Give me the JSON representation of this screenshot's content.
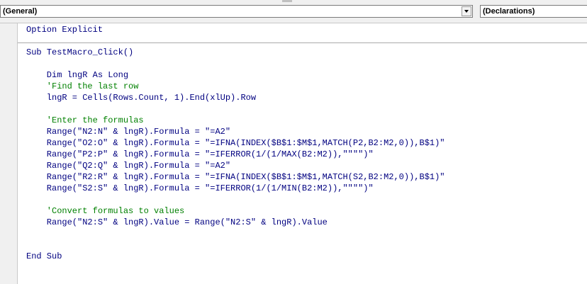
{
  "toolbar": {
    "object_combo": "(General)",
    "procedure_combo": "(Declarations)"
  },
  "code": {
    "option_explicit": "Option Explicit",
    "sub_decl": "Sub TestMacro_Click()",
    "dim_line": "    Dim lngR As Long",
    "comment_last_row": "    'Find the last row",
    "lngR_assign": "    lngR = Cells(Rows.Count, 1).End(xlUp).Row",
    "comment_formulas": "    'Enter the formulas",
    "range_n": "    Range(\"N2:N\" & lngR).Formula = \"=A2\"",
    "range_o": "    Range(\"O2:O\" & lngR).Formula = \"=IFNA(INDEX($B$1:$M$1,MATCH(P2,B2:M2,0)),B$1)\"",
    "range_p": "    Range(\"P2:P\" & lngR).Formula = \"=IFERROR(1/(1/MAX(B2:M2)),\"\"\"\")\"",
    "range_q": "    Range(\"Q2:Q\" & lngR).Formula = \"=A2\"",
    "range_r": "    Range(\"R2:R\" & lngR).Formula = \"=IFNA(INDEX($B$1:$M$1,MATCH(S2,B2:M2,0)),B$1)\"",
    "range_s": "    Range(\"S2:S\" & lngR).Formula = \"=IFERROR(1/(1/MIN(B2:M2)),\"\"\"\")\"",
    "comment_convert": "    'Convert formulas to values",
    "value_line": "    Range(\"N2:S\" & lngR).Value = Range(\"N2:S\" & lngR).Value",
    "end_sub": "End Sub"
  }
}
